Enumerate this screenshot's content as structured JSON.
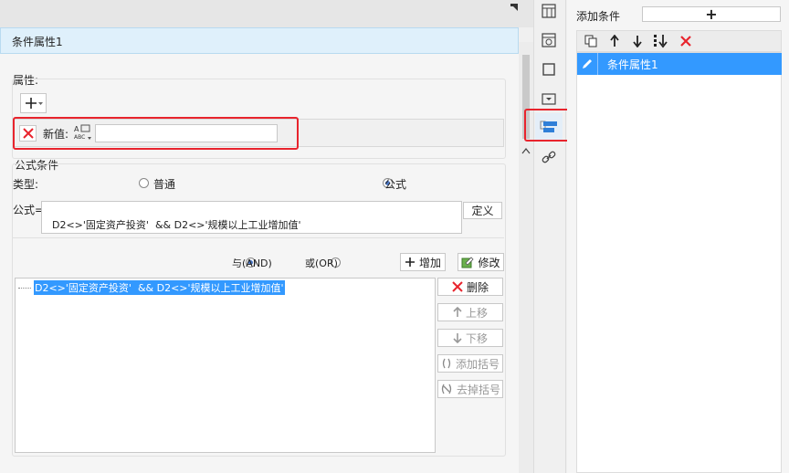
{
  "panel": {
    "title": "条件属性1",
    "attribute_section": "属性:",
    "new_value_label": "新值:",
    "new_value": "",
    "formula_section": "公式条件",
    "type_label": "类型:",
    "type_options": [
      "普通",
      "公式"
    ],
    "type_selected": "公式",
    "formula_label": "公式=",
    "formula_text": "D2<>'固定资产投资'  && D2<>'规模以上工业增加值'",
    "define_button": "定义",
    "logic_and": "与(AND)",
    "logic_or": "或(OR)",
    "logic_selected": "与(AND)",
    "add_button": "增加",
    "modify_button": "修改",
    "condition_items": [
      "D2<>'固定资产投资'  && D2<>'规模以上工业增加值'"
    ],
    "side_buttons": {
      "delete": "删除",
      "move_up": "上移",
      "move_down": "下移",
      "add_bracket": "添加括号",
      "remove_bracket": "去掉括号"
    }
  },
  "right": {
    "add_condition_label": "添加条件",
    "add_symbol": "+",
    "list_items": [
      "条件属性1"
    ]
  },
  "colors": {
    "accent": "#4a90d9",
    "selection": "#3399ff",
    "highlight_red": "#e8242d",
    "title_bar_bg": "#dff0fb"
  }
}
